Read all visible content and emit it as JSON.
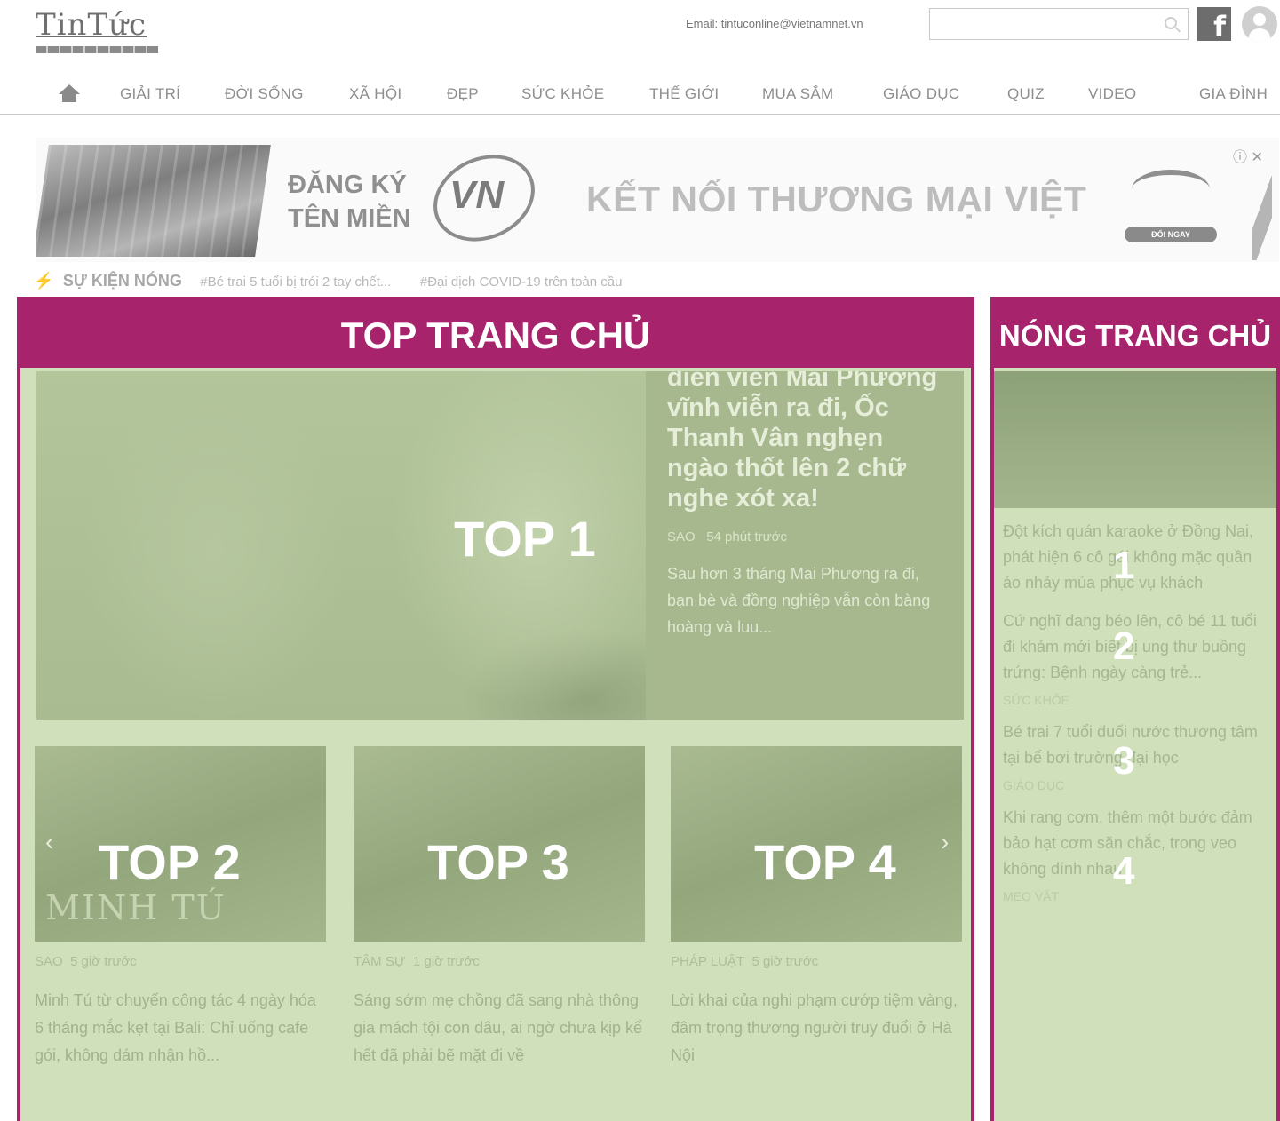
{
  "header": {
    "logo_text": "TinTức",
    "email": "Email: tintuconline@vietnamnet.vn",
    "search_placeholder": "",
    "facebook_glyph": "f"
  },
  "nav": {
    "items": [
      "GIẢI TRÍ",
      "ĐỜI SỐNG",
      "XÃ HỘI",
      "ĐẸP",
      "SỨC KHỎE",
      "THẾ GIỚI",
      "MUA SẮM",
      "GIÁO DỤC",
      "QUIZ",
      "VIDEO",
      "GIA ĐÌNH"
    ]
  },
  "banner": {
    "register": "ĐĂNG KÝ\nTÊN MIỀN",
    "vn": "VN",
    "headline": "KẾT NỐI THƯƠNG MẠI VIỆT",
    "badge_button": "ĐỔI NGAY",
    "close": "ⓘ ✕"
  },
  "hot_events": {
    "title": "SỰ KIỆN NÓNG",
    "tags": [
      "#Bé trai 5 tuổi bị trói 2 tay chết...",
      "#Đại dịch COVID-19 trên toàn cầu"
    ]
  },
  "main_panel": {
    "title": "TOP TRANG CHỦ",
    "top1": {
      "label": "TOP 1",
      "title": "diễn viên Mai Phương vĩnh viễn ra đi, Ốc Thanh Vân nghẹn ngào thốt lên 2 chữ nghe xót xa!",
      "category": "SAO",
      "time": "54 phút trước",
      "description": "Sau hơn 3 tháng Mai Phương ra đi, bạn bè và đồng nghiệp vẫn còn bàng hoàng và luu..."
    },
    "cards": [
      {
        "label": "TOP 2",
        "image_text": "MINH TÚ",
        "category": "SAO",
        "time": "5 giờ trước",
        "title": "Minh Tú từ chuyến công tác 4 ngày hóa 6 tháng mắc kẹt tại Bali: Chỉ uống cafe gói, không dám nhận hồ..."
      },
      {
        "label": "TOP 3",
        "image_text": "",
        "category": "TÂM SỰ",
        "time": "1 giờ trước",
        "title": "Sáng sớm mẹ chồng đã sang nhà thông gia mách tội con dâu, ai ngờ chưa kịp kể hết đã phải bẽ mặt đi về"
      },
      {
        "label": "TOP 4",
        "image_text": "",
        "category": "PHÁP LUẬT",
        "time": "5 giờ trước",
        "title": "Lời khai của nghi phạm cướp tiệm vàng, đâm trọng thương người truy đuổi ở Hà Nội"
      }
    ],
    "prev_arrow": "‹",
    "next_arrow": "›"
  },
  "side_panel": {
    "title": "NÓNG TRANG CHỦ",
    "items": [
      {
        "number": "1",
        "title": "Đột kích quán karaoke ở Đồng Nai, phát hiện 6 cô gái không mặc quần áo nhảy múa phục vụ khách",
        "category": ""
      },
      {
        "number": "2",
        "title": "Cứ nghĩ đang béo lên, cô bé 11 tuổi đi khám mới biết bị ung thư buồng trứng: Bệnh ngày càng trẻ...",
        "category": "SỨC KHỎE"
      },
      {
        "number": "3",
        "title": "Bé trai 7 tuổi đuối nước thương tâm tại bể bơi trường đại học",
        "category": "GIÁO DỤC"
      },
      {
        "number": "4",
        "title": "Khi rang cơm, thêm một bước đảm bảo hạt cơm săn chắc, trong veo không dính nhau",
        "category": "MẸO VẶT"
      }
    ]
  },
  "colors": {
    "accent": "#a7246d",
    "overlay": "#cfe0bb"
  },
  "icons": [
    "home-icon",
    "search-icon",
    "facebook-icon",
    "avatar-icon",
    "lightning-icon",
    "info-icon",
    "close-icon",
    "chevron-left-icon",
    "chevron-right-icon"
  ]
}
